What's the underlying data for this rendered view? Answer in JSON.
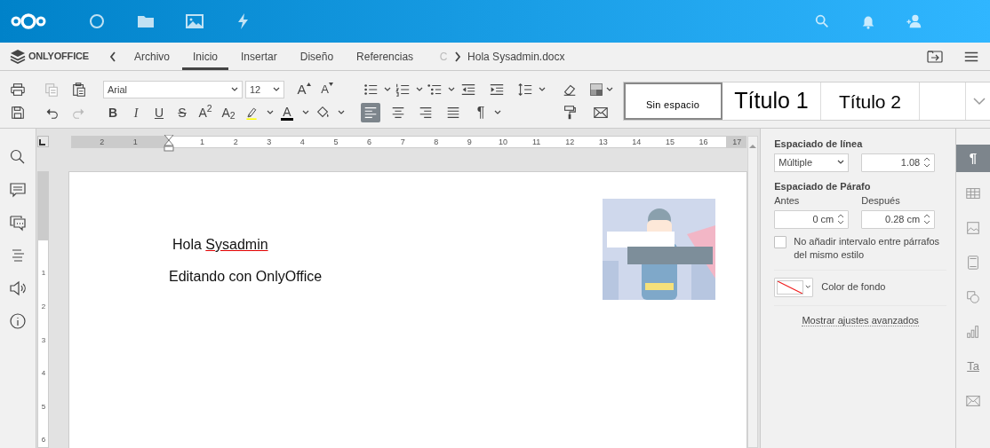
{
  "tabbar": {
    "logo": "ONLYOFFICE",
    "tabs": [
      {
        "label": "Archivo",
        "selected": false
      },
      {
        "label": "Inicio",
        "selected": true
      },
      {
        "label": "Insertar",
        "selected": false
      },
      {
        "label": "Diseño",
        "selected": false
      },
      {
        "label": "Referencias",
        "selected": false
      },
      {
        "label": "C",
        "selected": false
      }
    ],
    "document_title": "Hola Sysadmin.docx"
  },
  "toolbar": {
    "font_name": "Arial",
    "font_size": "12",
    "size_buttons": [
      {
        "label": "A",
        "kind": "grow"
      },
      {
        "label": "A",
        "kind": "shrink"
      }
    ],
    "format_buttons": [
      {
        "label": "B",
        "kind": "bold"
      },
      {
        "label": "I",
        "kind": "italic"
      },
      {
        "label": "U",
        "kind": "underline"
      },
      {
        "label": "S",
        "kind": "strike"
      },
      {
        "label": "A$^{2}$",
        "kind": "superscript"
      },
      {
        "label": "A$_{2}$",
        "kind": "subscript"
      }
    ],
    "font_color_label": "A",
    "align_buttons": [
      {
        "kind": "left",
        "selected": true
      },
      {
        "kind": "center",
        "selected": false
      },
      {
        "kind": "right",
        "selected": false
      },
      {
        "kind": "justify",
        "selected": false
      }
    ],
    "pilcrow": "¶",
    "styles": [
      {
        "label": "Sin espacio",
        "kind": "small",
        "selected": true
      },
      {
        "label": "Título 1",
        "kind": "h1",
        "selected": false
      },
      {
        "label": "Título 2",
        "kind": "h2",
        "selected": false
      }
    ]
  },
  "ruler": {
    "labels": [
      "2",
      "1",
      "1",
      "2",
      "3",
      "4",
      "5",
      "6",
      "7",
      "8",
      "9",
      "10",
      "11",
      "12",
      "13",
      "14",
      "15",
      "16",
      "17"
    ],
    "vertical_labels": [
      "1",
      "2",
      "3",
      "4",
      "5",
      "6"
    ]
  },
  "document": {
    "paragraphs": [
      {
        "parts": [
          {
            "text": "Hola",
            "spelling_error": false
          },
          {
            "text": "Sysadmin",
            "spelling_error": true
          }
        ]
      },
      {
        "parts": [
          {
            "text": "Editando con OnlyOffice",
            "spelling_error": false
          }
        ]
      }
    ]
  },
  "paragraph_settings": {
    "line_spacing_heading": "Espaciado de línea",
    "line_spacing_type": "Múltiple",
    "line_spacing_value": "1.08",
    "paragraph_spacing_heading": "Espaciado de Párafo",
    "before_label": "Antes",
    "before_value": "0 cm",
    "after_label": "Después",
    "after_value": "0.28 cm",
    "no_interval_label": "No añadir intervalo entre párrafos del mismo estilo",
    "no_interval_checked": false,
    "background_label": "Color de fondo",
    "advanced_link": "Mostrar ajustes avanzados"
  },
  "right_tabs": [
    {
      "kind": "paragraph",
      "label": "¶",
      "selected": true
    },
    {
      "kind": "table",
      "selected": false
    },
    {
      "kind": "image",
      "selected": false
    },
    {
      "kind": "header",
      "selected": false
    },
    {
      "kind": "shape",
      "selected": false
    },
    {
      "kind": "chart",
      "selected": false
    },
    {
      "kind": "textart",
      "label": "Ta",
      "selected": false
    },
    {
      "kind": "mail",
      "selected": false
    }
  ]
}
